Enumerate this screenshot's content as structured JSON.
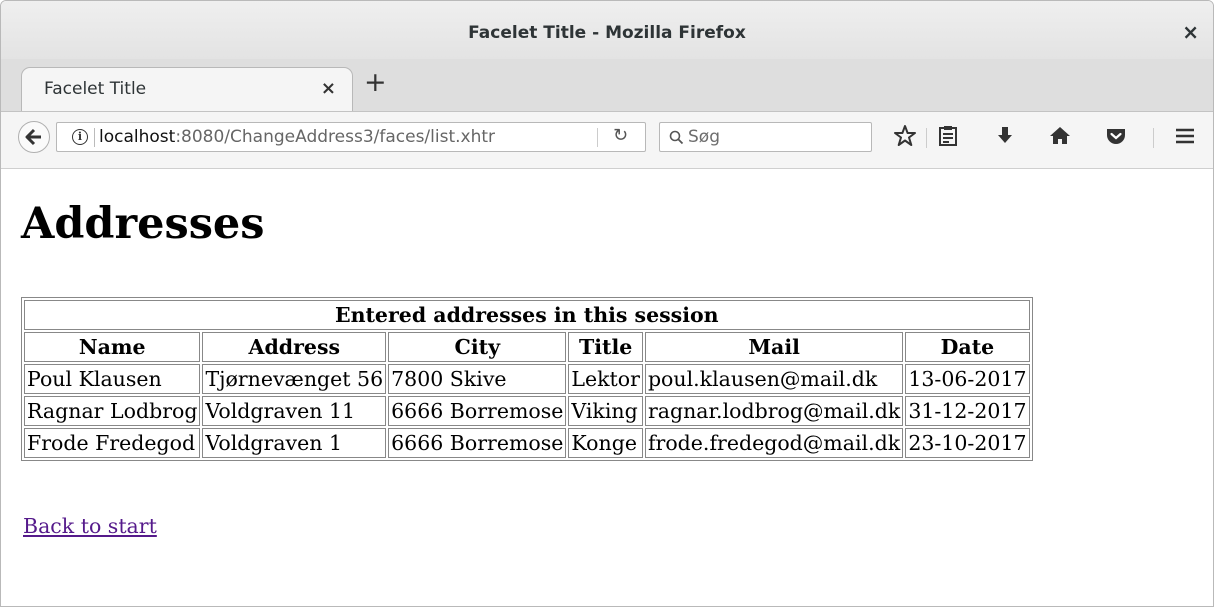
{
  "window": {
    "title": "Facelet Title - Mozilla Firefox",
    "close_label": "×"
  },
  "tabs": [
    {
      "label": "Facelet Title",
      "close_label": "×"
    }
  ],
  "new_tab_label": "+",
  "navbar": {
    "url_host": "localhost",
    "url_rest": ":8080/ChangeAddress3/faces/list.xhtr",
    "search_placeholder": "Søg",
    "icons": [
      "back-arrow-icon",
      "info-icon",
      "reload-icon",
      "search-icon",
      "star-icon",
      "reading-list-icon",
      "download-icon",
      "home-icon",
      "pocket-icon",
      "menu-icon"
    ]
  },
  "page": {
    "heading": "Addresses",
    "table": {
      "caption": "Entered addresses in this session",
      "columns": [
        "Name",
        "Address",
        "City",
        "Title",
        "Mail",
        "Date"
      ],
      "rows": [
        [
          "Poul Klausen",
          "Tjørnevænget 56",
          "7800 Skive",
          "Lektor",
          "poul.klausen@mail.dk",
          "13-06-2017"
        ],
        [
          "Ragnar Lodbrog",
          "Voldgraven 11",
          "6666 Borremose",
          "Viking",
          "ragnar.lodbrog@mail.dk",
          "31-12-2017"
        ],
        [
          "Frode Fredegod",
          "Voldgraven 1",
          "6666 Borremose",
          "Konge",
          "frode.fredegod@mail.dk",
          "23-10-2017"
        ]
      ]
    },
    "back_link": "Back to start"
  },
  "colors": {
    "visited_link": "#551a8b",
    "chrome_background": "#f5f5f5",
    "tab_strip": "#dedede"
  }
}
